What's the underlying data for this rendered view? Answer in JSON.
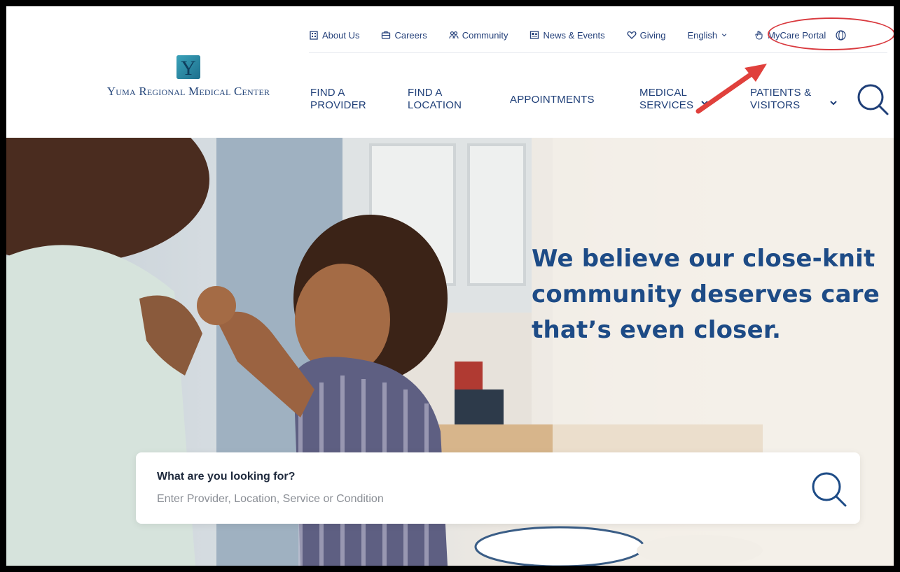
{
  "brand": {
    "name": "Yuma Regional Medical Center",
    "logo_letter": "Y",
    "colors": {
      "navy": "#1f3f78",
      "headline": "#1d4b86",
      "teal": "#2a8aa6",
      "annotation": "#d9393e"
    }
  },
  "utility_nav": [
    {
      "label": "About Us",
      "icon": "building-icon"
    },
    {
      "label": "Careers",
      "icon": "briefcase-icon"
    },
    {
      "label": "Community",
      "icon": "people-icon"
    },
    {
      "label": "News & Events",
      "icon": "newspaper-icon"
    },
    {
      "label": "Giving",
      "icon": "heart-icon"
    },
    {
      "label": "English",
      "icon": "chevron-down-icon"
    },
    {
      "label": "MyCare Portal",
      "icon": "hand-icon"
    }
  ],
  "main_nav": [
    {
      "line1": "FIND A",
      "line2": "PROVIDER"
    },
    {
      "line1": "FIND A",
      "line2": "LOCATION"
    },
    {
      "line1": "APPOINTMENTS",
      "line2": ""
    },
    {
      "line1": "MEDICAL",
      "line2": "SERVICES"
    },
    {
      "line1": "PATIENTS &",
      "line2": "VISITORS"
    }
  ],
  "hero": {
    "headline_lines": [
      "We believe our close-knit",
      "community deserves care",
      "that’s even closer."
    ]
  },
  "search": {
    "label": "What are you looking for?",
    "placeholder": "Enter Provider, Location, Service or Condition"
  }
}
